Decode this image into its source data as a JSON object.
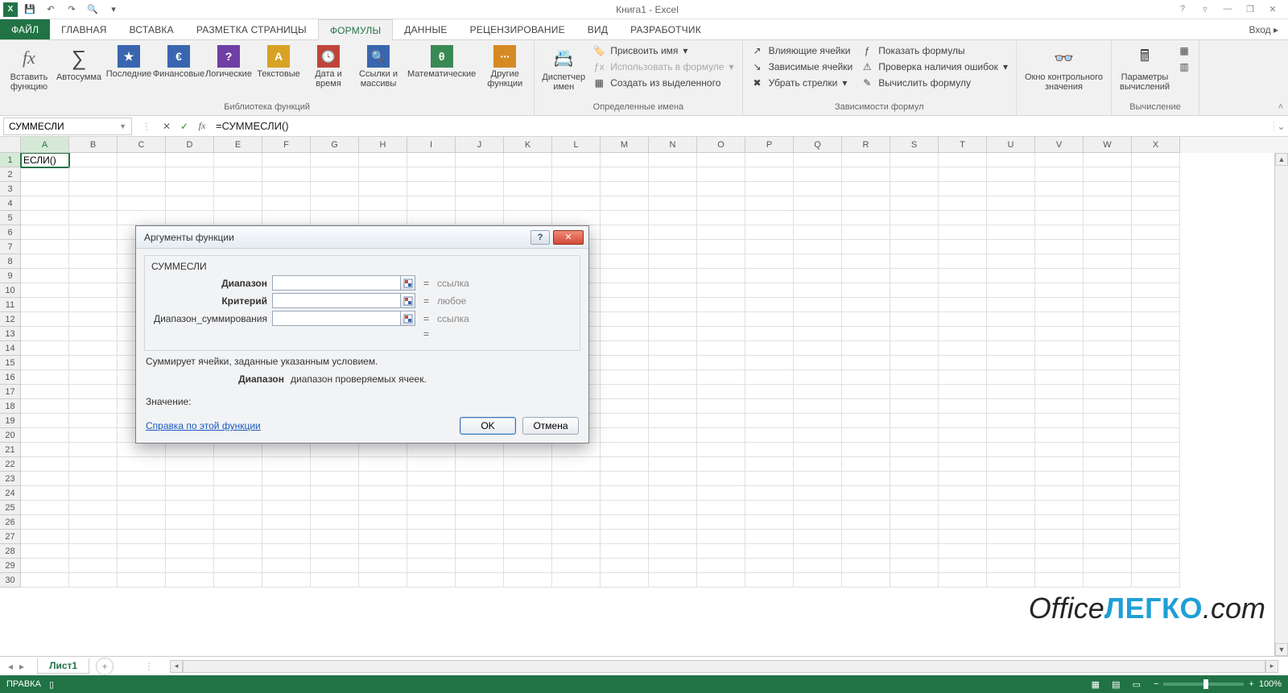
{
  "app": {
    "title": "Книга1 - Excel",
    "login": "Вход"
  },
  "qat": {
    "save": "💾",
    "undo": "↶",
    "redo": "↷",
    "preview": "🔍"
  },
  "win": {
    "help": "?",
    "ribbonopts": "▿",
    "min": "—",
    "restore": "❐",
    "close": "✕"
  },
  "tabs": {
    "file": "ФАЙЛ",
    "home": "ГЛАВНАЯ",
    "insert": "ВСТАВКА",
    "layout": "РАЗМЕТКА СТРАНИЦЫ",
    "formulas": "ФОРМУЛЫ",
    "data": "ДАННЫЕ",
    "review": "РЕЦЕНЗИРОВАНИЕ",
    "view": "ВИД",
    "dev": "РАЗРАБОТЧИК"
  },
  "ribbon": {
    "groups": {
      "library": "Библиотека функций",
      "names": "Определенные имена",
      "audit": "Зависимости формул",
      "calc": "Вычисление"
    },
    "insertfn": "Вставить\nфункцию",
    "autosum": "Автосумма",
    "recent": "Последние",
    "financial": "Финансовые",
    "logical": "Логические",
    "text": "Текстовые",
    "datetime": "Дата и\nвремя",
    "lookup": "Ссылки и\nмассивы",
    "math": "Математические",
    "other": "Другие\nфункции",
    "namemgr": "Диспетчер\nимен",
    "defname": "Присвоить имя",
    "useinf": "Использовать в формуле",
    "fromsel": "Создать из выделенного",
    "traceprec": "Влияющие ячейки",
    "tracedep": "Зависимые ячейки",
    "removearr": "Убрать стрелки",
    "showf": "Показать формулы",
    "errchk": "Проверка наличия ошибок",
    "eval": "Вычислить формулу",
    "watch": "Окно контрольного\nзначения",
    "calcopts": "Параметры\nвычислений"
  },
  "fbar": {
    "name": "СУММЕСЛИ",
    "formula": "=СУММЕСЛИ()"
  },
  "cells": {
    "A1": "ЕСЛИ()"
  },
  "columns": [
    "A",
    "B",
    "C",
    "D",
    "E",
    "F",
    "G",
    "H",
    "I",
    "J",
    "K",
    "L",
    "M",
    "N",
    "O",
    "P",
    "Q",
    "R",
    "S",
    "T",
    "U",
    "V",
    "W",
    "X"
  ],
  "rows": 30,
  "sheet": {
    "name": "Лист1"
  },
  "status": {
    "mode": "ПРАВКА",
    "zoom": "100%"
  },
  "dialog": {
    "title": "Аргументы функции",
    "func": "СУММЕСЛИ",
    "args": [
      {
        "label": "Диапазон",
        "bold": true,
        "hint": "ссылка"
      },
      {
        "label": "Критерий",
        "bold": true,
        "hint": "любое"
      },
      {
        "label": "Диапазон_суммирования",
        "bold": false,
        "hint": "ссылка"
      }
    ],
    "eq": "=",
    "desc": "Суммирует ячейки, заданные указанным условием.",
    "argdesc_name": "Диапазон",
    "argdesc_text": "диапазон проверяемых ячеек.",
    "valuelabel": "Значение:",
    "help": "Справка по этой функции",
    "ok": "OK",
    "cancel": "Отмена"
  },
  "watermark": {
    "a": "Office",
    "b": "ЛЕГКО",
    "c": ".com"
  }
}
